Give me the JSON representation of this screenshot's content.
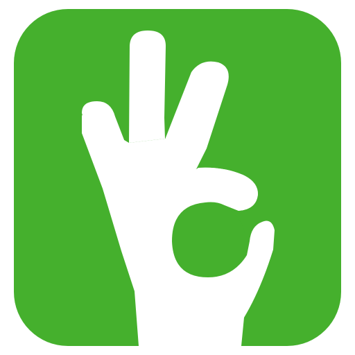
{
  "icon": {
    "name": "ok-hand-gesture-icon",
    "background_color": "#45B02D",
    "foreground_color": "#FFFFFF",
    "page_background": "#FFFFFF"
  }
}
